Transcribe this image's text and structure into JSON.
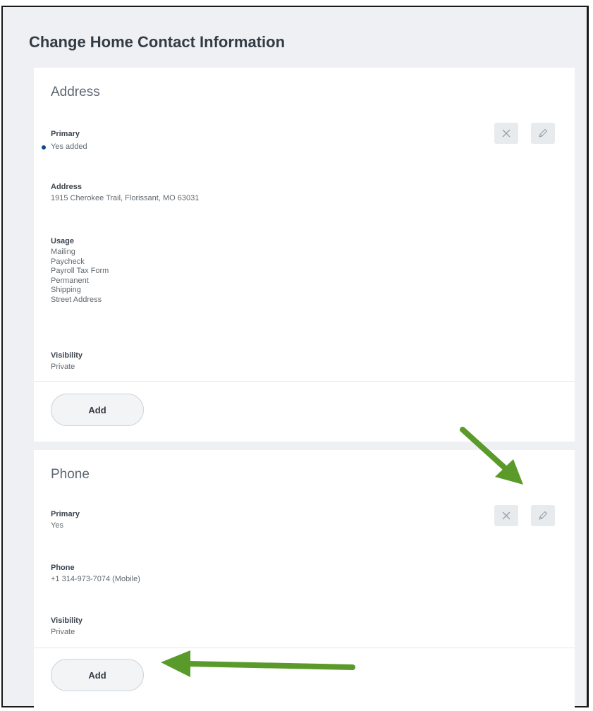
{
  "page": {
    "title": "Change Home Contact Information"
  },
  "address_section": {
    "title": "Address",
    "primary": {
      "label": "Primary",
      "value": "Yes  added"
    },
    "address": {
      "label": "Address",
      "value": "1915 Cherokee Trail, Florissant, MO 63031"
    },
    "usage": {
      "label": "Usage",
      "values": [
        "Mailing",
        "Paycheck",
        "Payroll Tax Form",
        "Permanent",
        "Shipping",
        "Street Address"
      ]
    },
    "visibility": {
      "label": "Visibility",
      "value": "Private"
    },
    "add_label": "Add"
  },
  "phone_section": {
    "title": "Phone",
    "primary": {
      "label": "Primary",
      "value": "Yes"
    },
    "phone": {
      "label": "Phone",
      "value": "+1 314-973-7074 (Mobile)"
    },
    "visibility": {
      "label": "Visibility",
      "value": "Private"
    },
    "add_label": "Add"
  },
  "colors": {
    "accent_dot": "#0f4a86",
    "annotation_arrow": "#5a9a2b"
  },
  "icons": [
    "close-icon",
    "pencil-icon",
    "arrow-annotation"
  ]
}
